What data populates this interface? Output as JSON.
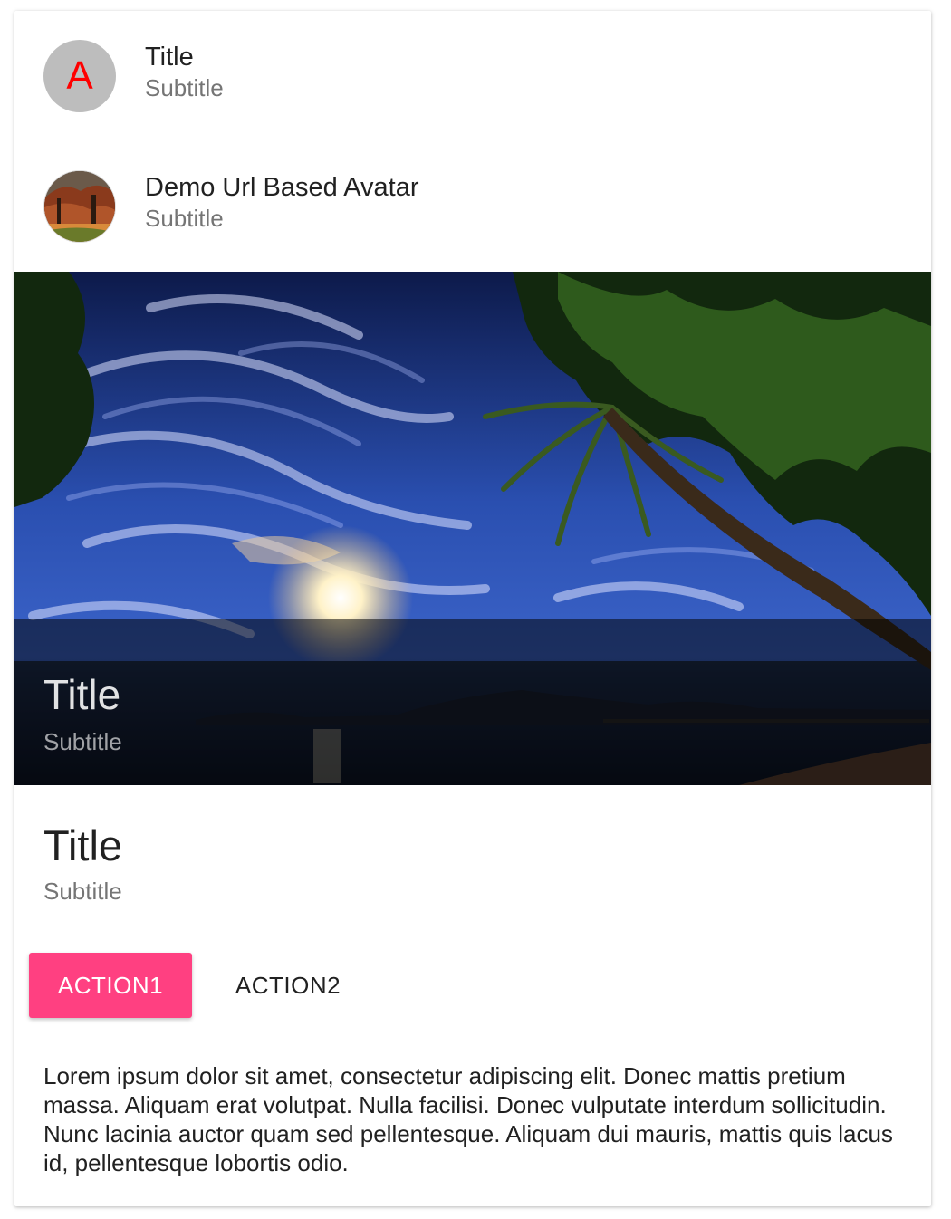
{
  "card": {
    "header1": {
      "avatar_letter": "A",
      "title": "Title",
      "subtitle": "Subtitle"
    },
    "header2": {
      "avatar_icon": "landscape-photo-avatar",
      "title": "Demo Url Based Avatar",
      "subtitle": "Subtitle"
    },
    "media": {
      "image": "tropical-beach-sunset-with-palm-trees",
      "overlay_title": "Title",
      "overlay_subtitle": "Subtitle"
    },
    "title_block": {
      "title": "Title",
      "subtitle": "Subtitle"
    },
    "actions": {
      "action1_label": "ACTION1",
      "action2_label": "ACTION2"
    },
    "text": "Lorem ipsum dolor sit amet, consectetur adipiscing elit. Donec mattis pretium massa. Aliquam erat volutpat. Nulla facilisi. Donec vulputate interdum sollicitudin. Nunc lacinia auctor quam sed pellentesque. Aliquam dui mauris, mattis quis lacus id, pellentesque lobortis odio."
  },
  "colors": {
    "accent": "#ff4081",
    "avatar_bg": "#bdbdbd",
    "avatar_letter": "#ff0000",
    "primary_text": "#212121",
    "secondary_text": "#757575"
  }
}
